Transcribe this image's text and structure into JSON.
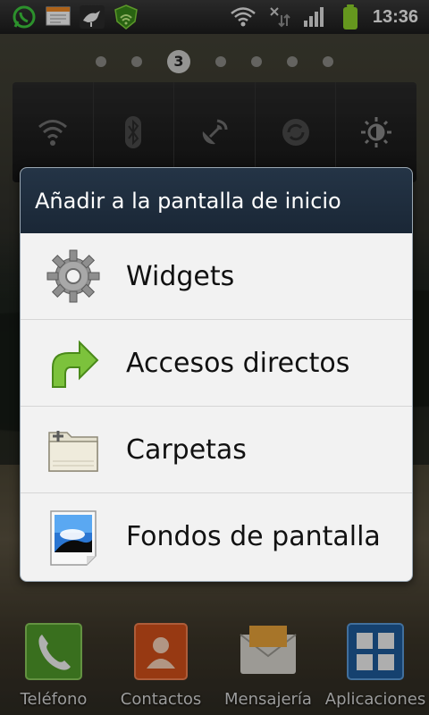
{
  "status_bar": {
    "left_icons": [
      "whatsapp-icon",
      "notes-icon",
      "bird-app-icon",
      "security-icon"
    ],
    "right_icons": [
      "wifi-icon",
      "data-sync-icon",
      "signal-icon",
      "battery-icon"
    ],
    "time": "13:36"
  },
  "home": {
    "current_page": "3"
  },
  "dialog": {
    "title": "Añadir a la pantalla de inicio",
    "items": [
      {
        "label": "Widgets",
        "icon": "gear-icon"
      },
      {
        "label": "Accesos directos",
        "icon": "shortcut-arrow-icon"
      },
      {
        "label": "Carpetas",
        "icon": "folder-icon"
      },
      {
        "label": "Fondos de pantalla",
        "icon": "wallpaper-icon"
      }
    ]
  },
  "dock": {
    "items": [
      {
        "label": "Teléfono",
        "icon": "phone-icon"
      },
      {
        "label": "Contactos",
        "icon": "contacts-icon"
      },
      {
        "label": "Mensajería",
        "icon": "messaging-icon"
      },
      {
        "label": "Aplicaciones",
        "icon": "apps-grid-icon"
      }
    ]
  },
  "colors": {
    "dialog_title_bg": "#1f2e3f",
    "dialog_body_bg": "#f2f2f2",
    "battery_green": "#8cd12a"
  }
}
